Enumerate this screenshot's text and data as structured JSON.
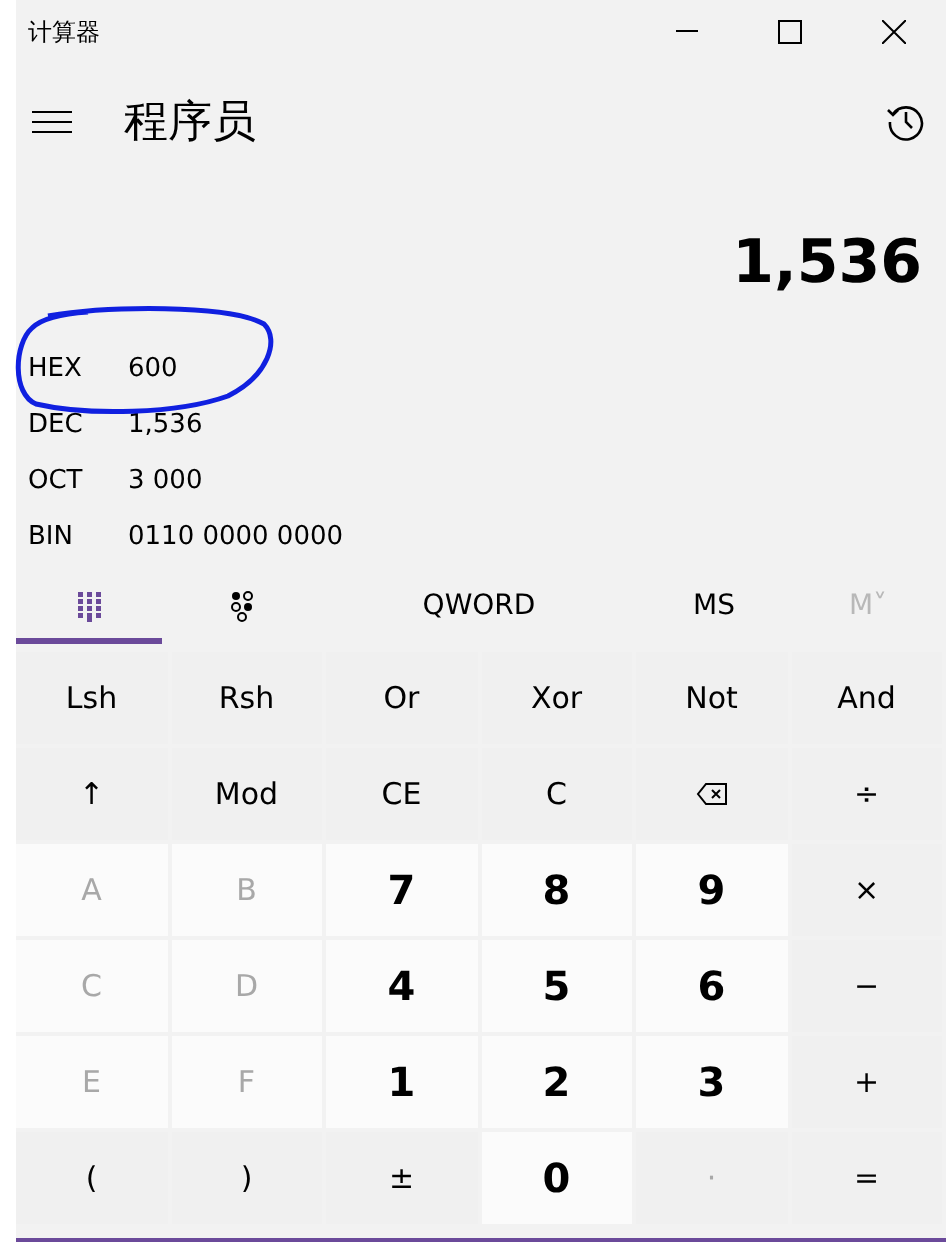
{
  "window": {
    "title": "计算器"
  },
  "header": {
    "title": "程序员"
  },
  "display": {
    "value": "1,536"
  },
  "radix": [
    {
      "label": "HEX",
      "value": "600"
    },
    {
      "label": "DEC",
      "value": "1,536"
    },
    {
      "label": "OCT",
      "value": "3 000"
    },
    {
      "label": "BIN",
      "value": "0110 0000 0000"
    }
  ],
  "tabs": [
    {
      "kind": "keypad",
      "selected": true,
      "disabled": false
    },
    {
      "kind": "bits",
      "selected": false,
      "disabled": false
    },
    {
      "kind": "text",
      "label": "QWORD",
      "selected": false,
      "disabled": false
    },
    {
      "kind": "text",
      "label": "MS",
      "selected": false,
      "disabled": false
    },
    {
      "kind": "text",
      "label": "M˅",
      "selected": false,
      "disabled": true
    }
  ],
  "keys": [
    {
      "kind": "op",
      "label": "Lsh",
      "disabled": false
    },
    {
      "kind": "op",
      "label": "Rsh",
      "disabled": false
    },
    {
      "kind": "op",
      "label": "Or",
      "disabled": false
    },
    {
      "kind": "op",
      "label": "Xor",
      "disabled": false
    },
    {
      "kind": "op",
      "label": "Not",
      "disabled": false
    },
    {
      "kind": "op",
      "label": "And",
      "disabled": false
    },
    {
      "kind": "op",
      "label": "↑",
      "disabled": false
    },
    {
      "kind": "op",
      "label": "Mod",
      "disabled": false
    },
    {
      "kind": "op",
      "label": "CE",
      "disabled": false
    },
    {
      "kind": "op",
      "label": "C",
      "disabled": false
    },
    {
      "kind": "backspace",
      "disabled": false
    },
    {
      "kind": "op",
      "label": "÷",
      "disabled": false
    },
    {
      "kind": "digit",
      "label": "A",
      "disabled": true
    },
    {
      "kind": "digit",
      "label": "B",
      "disabled": true
    },
    {
      "kind": "digit",
      "label": "7",
      "disabled": false
    },
    {
      "kind": "digit",
      "label": "8",
      "disabled": false
    },
    {
      "kind": "digit",
      "label": "9",
      "disabled": false
    },
    {
      "kind": "op",
      "label": "×",
      "disabled": false
    },
    {
      "kind": "digit",
      "label": "C",
      "disabled": true
    },
    {
      "kind": "digit",
      "label": "D",
      "disabled": true
    },
    {
      "kind": "digit",
      "label": "4",
      "disabled": false
    },
    {
      "kind": "digit",
      "label": "5",
      "disabled": false
    },
    {
      "kind": "digit",
      "label": "6",
      "disabled": false
    },
    {
      "kind": "op",
      "label": "−",
      "disabled": false
    },
    {
      "kind": "digit",
      "label": "E",
      "disabled": true
    },
    {
      "kind": "digit",
      "label": "F",
      "disabled": true
    },
    {
      "kind": "digit",
      "label": "1",
      "disabled": false
    },
    {
      "kind": "digit",
      "label": "2",
      "disabled": false
    },
    {
      "kind": "digit",
      "label": "3",
      "disabled": false
    },
    {
      "kind": "op",
      "label": "+",
      "disabled": false
    },
    {
      "kind": "op",
      "label": "(",
      "disabled": false
    },
    {
      "kind": "op",
      "label": ")",
      "disabled": false
    },
    {
      "kind": "op",
      "label": "±",
      "disabled": false
    },
    {
      "kind": "digit",
      "label": "0",
      "disabled": false
    },
    {
      "kind": "op",
      "label": "·",
      "disabled": true
    },
    {
      "kind": "op",
      "label": "=",
      "disabled": false
    }
  ]
}
